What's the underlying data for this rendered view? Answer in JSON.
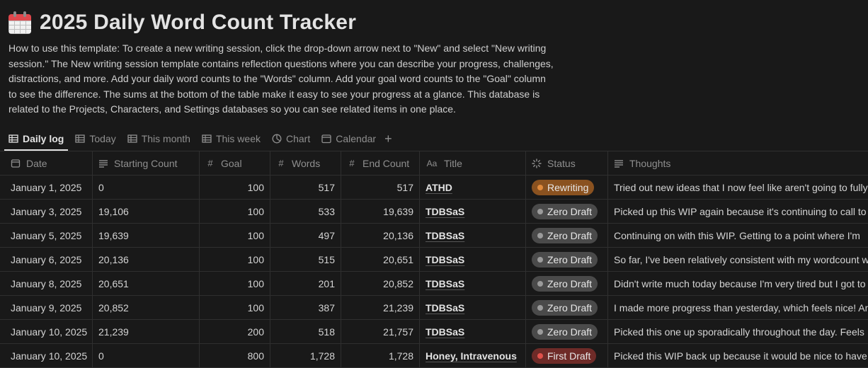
{
  "page": {
    "title": "2025 Daily Word Count Tracker",
    "icon": "calendar-icon",
    "description": "How to use this template: To create a new writing session, click the drop-down arrow next to \"New\" and select \"New writing session.\" The New writing session template contains reflection questions where you can describe your progress, challenges, distractions, and more. Add your daily word counts to the \"Words\" column. Add your goal word counts to the \"Goal\" column to see the difference. The sums at the bottom of the table make it easy to see your progress at a glance. This database is related to the Projects, Characters, and Settings databases so you can see related items in one place."
  },
  "tabs": [
    {
      "label": "Daily log",
      "icon": "table-icon",
      "active": true
    },
    {
      "label": "Today",
      "icon": "table-icon"
    },
    {
      "label": "This month",
      "icon": "table-icon"
    },
    {
      "label": "This week",
      "icon": "table-icon"
    },
    {
      "label": "Chart",
      "icon": "chart-icon"
    },
    {
      "label": "Calendar",
      "icon": "calendar-icon"
    }
  ],
  "add_view_label": "+",
  "columns": {
    "date": "Date",
    "starting_count": "Starting Count",
    "goal": "Goal",
    "words": "Words",
    "end_count": "End Count",
    "title": "Title",
    "status": "Status",
    "thoughts": "Thoughts"
  },
  "column_icons": {
    "date": "calendar-icon",
    "starting_count": "text-icon",
    "goal": "number-icon",
    "words": "number-icon",
    "end_count": "number-icon",
    "title": "title-icon",
    "status": "status-icon",
    "thoughts": "text-icon"
  },
  "status_colors": {
    "Rewriting": {
      "bg": "#8a5220",
      "dot": "#e08a3c"
    },
    "Zero Draft": {
      "bg": "#4a4a4a",
      "dot": "#9b9b9b"
    },
    "First Draft": {
      "bg": "#6e2b28",
      "dot": "#e0514b"
    }
  },
  "rows": [
    {
      "date": "January 1, 2025",
      "starting_count": "0",
      "goal": "100",
      "words": "517",
      "end_count": "517",
      "title": "ATHD",
      "status": "Rewriting",
      "thoughts": "Tried out new ideas that I now feel like aren't going to fully"
    },
    {
      "date": "January 3, 2025",
      "starting_count": "19,106",
      "goal": "100",
      "words": "533",
      "end_count": "19,639",
      "title": "TDBSaS",
      "status": "Zero Draft",
      "thoughts": "Picked up this WIP again because it's continuing to call to"
    },
    {
      "date": "January 5, 2025",
      "starting_count": "19,639",
      "goal": "100",
      "words": "497",
      "end_count": "20,136",
      "title": "TDBSaS",
      "status": "Zero Draft",
      "thoughts": "Continuing on with this WIP. Getting to a point where I'm"
    },
    {
      "date": "January 6, 2025",
      "starting_count": "20,136",
      "goal": "100",
      "words": "515",
      "end_count": "20,651",
      "title": "TDBSaS",
      "status": "Zero Draft",
      "thoughts": "So far, I've been relatively consistent with my wordcount w"
    },
    {
      "date": "January 8, 2025",
      "starting_count": "20,651",
      "goal": "100",
      "words": "201",
      "end_count": "20,852",
      "title": "TDBSaS",
      "status": "Zero Draft",
      "thoughts": "Didn't write much today because I'm very tired but I got to"
    },
    {
      "date": "January 9, 2025",
      "starting_count": "20,852",
      "goal": "100",
      "words": "387",
      "end_count": "21,239",
      "title": "TDBSaS",
      "status": "Zero Draft",
      "thoughts": "I made more progress than yesterday, which feels nice! An"
    },
    {
      "date": "January 10, 2025",
      "starting_count": "21,239",
      "goal": "200",
      "words": "518",
      "end_count": "21,757",
      "title": "TDBSaS",
      "status": "Zero Draft",
      "thoughts": "Picked this one up sporadically throughout the day. Feels"
    },
    {
      "date": "January 10, 2025",
      "starting_count": "0",
      "goal": "800",
      "words": "1,728",
      "end_count": "1,728",
      "title": "Honey, Intravenous",
      "status": "First Draft",
      "thoughts": "Picked this WIP back up because it would be nice to have"
    }
  ]
}
